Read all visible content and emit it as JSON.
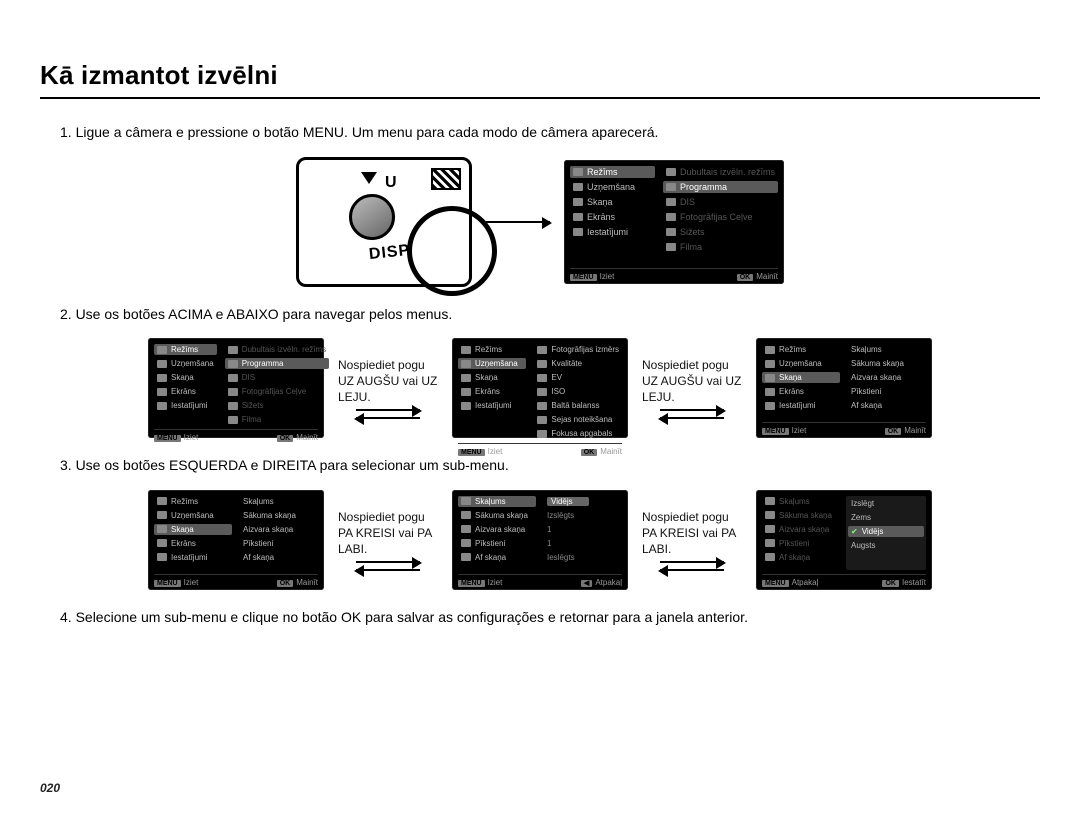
{
  "title": "Kā izmantot izvēlni",
  "page_number": "020",
  "steps": {
    "s1": "1. Ligue a câmera e pressione o botão MENU. Um menu para cada modo de câmera aparecerá.",
    "s2": "2. Use os botões ACIMA e ABAIXO para navegar pelos menus.",
    "s3": "3. Use os botões ESQUERDA e DIREITA para selecionar um sub-menu.",
    "s4": "4. Selecione um sub-menu e clique no botão OK para salvar as configurações e retornar para a janela anterior."
  },
  "caption_updown": "Nospiediet pogu UZ AUGŠU vai UZ LEJU.",
  "caption_leftright": "Nospiediet pogu PA KREISI vai PA LABI.",
  "main_menu": [
    "Režīms",
    "Uzņemšana",
    "Skaņa",
    "Ekrāns",
    "Iestatījumi"
  ],
  "sub_mode": [
    "Dubultais izvēln. režīms",
    "Programma",
    "DIS",
    "Fotogrāfijas Ceļve",
    "Sižets",
    "Filma"
  ],
  "sub_shoot": [
    "Fotogrāfijas izmērs",
    "Kvalitāte",
    "EV",
    "ISO",
    "Baltā balanss",
    "Sejas noteikšana",
    "Fokusa apgabals"
  ],
  "sub_sound_left": [
    "Skaļums",
    "Sākuma skaņa",
    "Aizvara skaņa",
    "Pīkstieni",
    "Af skaņa"
  ],
  "sub_sound_vals": {
    "col1": [
      "Skaļums",
      "Sākuma skaņa",
      "Aizvara skaņa",
      "Pīkstieni",
      "Af skaņa"
    ],
    "col2": [
      "Vidējs",
      "Izslēgts",
      "1",
      "1",
      "Ieslēgts"
    ]
  },
  "sub_volume_opts": [
    "Izslēgt",
    "Zems",
    "Vidējs",
    "Augsts"
  ],
  "footer": {
    "exit_label": "Iziet",
    "change_label": "Mainīt",
    "back_label": "Atpakaļ",
    "set_label": "Iestatīt",
    "menu_badge": "MENU",
    "ok_badge": "OK"
  },
  "camera": {
    "label": "DISP"
  }
}
